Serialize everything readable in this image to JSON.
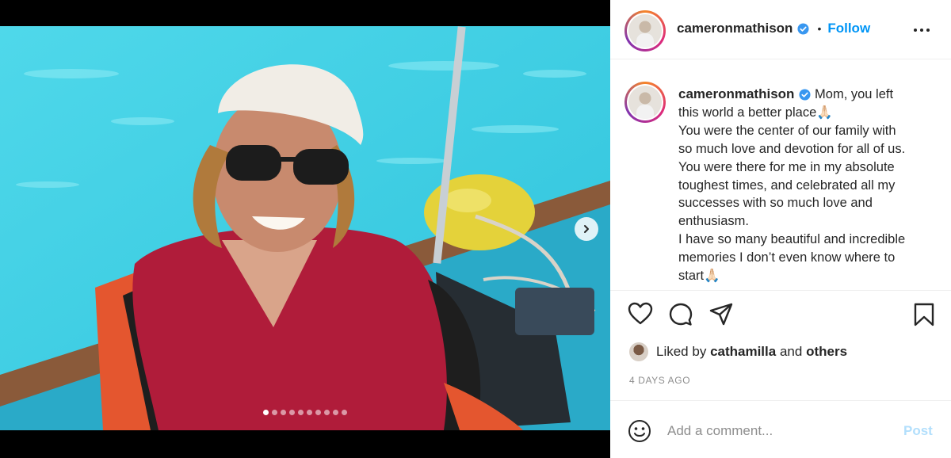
{
  "post": {
    "username": "cameronmathison",
    "separator": "•",
    "follow_label": "Follow",
    "verified": true,
    "carousel": {
      "total_slides": 10,
      "active_slide": 1
    }
  },
  "caption": {
    "username": "cameronmathison",
    "lines": [
      " Mom, you left",
      "this world a better place🙏🏻",
      "You were the center of our family with",
      "so much love and devotion for all of us.",
      "You were there for me in my absolute",
      "toughest times, and celebrated all my",
      "successes with so much love and",
      "enthusiasm.",
      "I have so many beautiful and incredible",
      "memories I don’t even know where to",
      "start🙏🏻"
    ]
  },
  "likes": {
    "prefix": "Liked by ",
    "first_liker": "cathamilla",
    "middle": " and ",
    "others": "others"
  },
  "timestamp": "4 DAYS AGO",
  "comment": {
    "placeholder": "Add a comment...",
    "post_label": "Post"
  },
  "icons": {
    "verified": "verified-badge-icon",
    "more": "more-options-icon",
    "like": "heart-icon",
    "comment": "comment-icon",
    "share": "share-icon",
    "save": "bookmark-icon",
    "emoji": "emoji-icon",
    "next": "chevron-right-icon"
  },
  "colors": {
    "accent": "#0095f6",
    "verified": "#3897f0",
    "muted": "#8e8e8e",
    "post_disabled": "#b2dffc"
  }
}
